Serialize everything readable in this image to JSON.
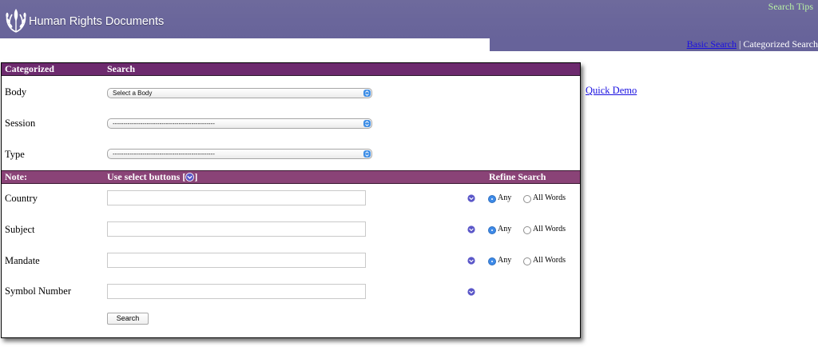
{
  "header": {
    "app_title": "Human Rights Documents",
    "search_tips": "Search Tips",
    "nav": {
      "basic_search": "Basic Search",
      "separator": "|",
      "categorized_search": "Categorized Search"
    }
  },
  "panel": {
    "band1": {
      "left": "Categorized",
      "right": "Search"
    },
    "selects": [
      {
        "label": "Body",
        "value": "Select a Body"
      },
      {
        "label": "Session",
        "value": "------------------------------------------------"
      },
      {
        "label": "Type",
        "value": "------------------------------------------------"
      }
    ],
    "band2": {
      "left": "Note:",
      "middle_prefix": "Use select buttons [",
      "middle_suffix": "]",
      "right": "Refine Search"
    },
    "fields": [
      {
        "label": "Country",
        "value": "",
        "radio_any": "Any",
        "radio_all": "All Words",
        "selected": "Any"
      },
      {
        "label": "Subject",
        "value": "",
        "radio_any": "Any",
        "radio_all": "All Words",
        "selected": "Any"
      },
      {
        "label": "Mandate",
        "value": "",
        "radio_any": "Any",
        "radio_all": "All Words",
        "selected": "Any"
      },
      {
        "label": "Symbol Number",
        "value": ""
      }
    ],
    "search_button": "Search"
  },
  "quick_demo": "Quick Demo",
  "colors": {
    "header_bg": "#67639a",
    "band1_bg": "#6d2a6e",
    "band2_bg": "#8a4377",
    "search_tips": "#b9f2a4",
    "link": "#1a10e0",
    "radio_selected": "#3d8ae8"
  },
  "icons": {
    "logo": "un-laurel-logo",
    "dropdown": "chevron-down-circle-icon",
    "select_arrow": "select-arrows-icon"
  }
}
